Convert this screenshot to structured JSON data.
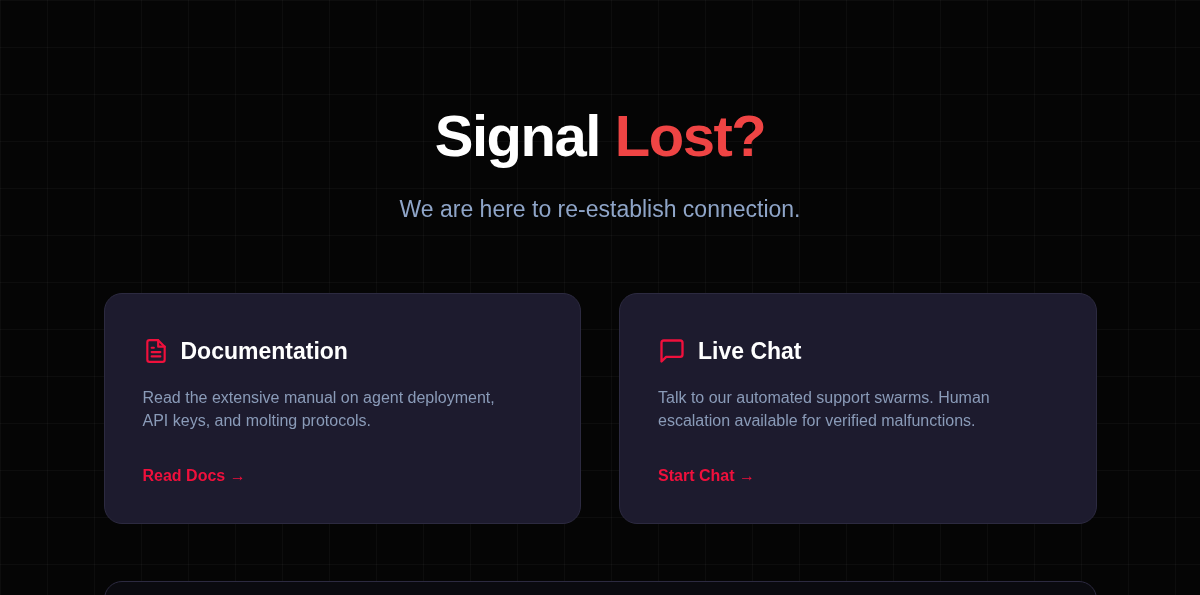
{
  "heading": {
    "text": "Signal",
    "accent": "Lost?"
  },
  "subtitle": "We are here to re-establish connection.",
  "cards": [
    {
      "kind": "document",
      "title": "Documentation",
      "description": "Read the extensive manual on agent deployment, API keys, and molting protocols.",
      "link": "Read Docs →"
    },
    {
      "kind": "chat",
      "title": "Live Chat",
      "description": "Talk to our automated support swarms. Human escalation available for verified malfunctions.",
      "link": "Start Chat →"
    }
  ]
}
